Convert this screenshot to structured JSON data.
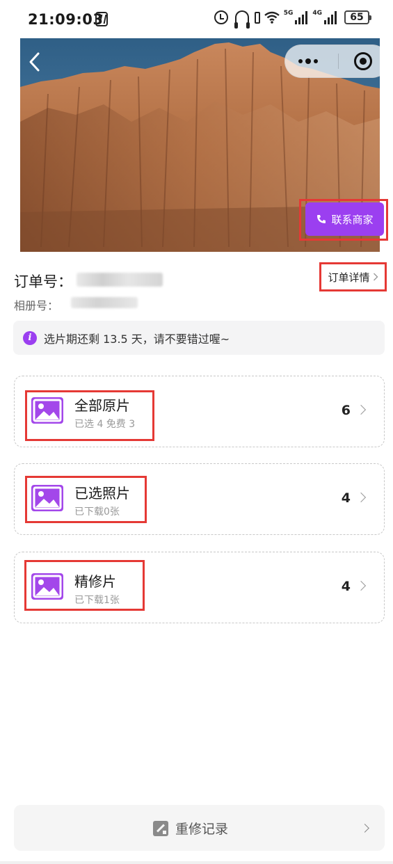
{
  "status_bar": {
    "time": "21:09:03",
    "net_5g": "5G",
    "net_4g": "4G",
    "battery": "65"
  },
  "hero": {
    "contact_label": "联系商家"
  },
  "order": {
    "order_no_label": "订单号：",
    "album_no_label": "相册号：",
    "detail_label": "订单详情"
  },
  "notice": {
    "info_symbol": "i",
    "text": "选片期还剩 13.5 天，请不要错过喔~"
  },
  "cards": [
    {
      "title": "全部原片",
      "subtitle": "已选 4 免费 3",
      "count": "6"
    },
    {
      "title": "已选照片",
      "subtitle": "已下载0张",
      "count": "4"
    },
    {
      "title": "精修片",
      "subtitle": "已下载1张",
      "count": "4"
    }
  ],
  "bottom": {
    "retouch_label": "重修记录"
  },
  "colors": {
    "accent": "#9b3ff0",
    "highlight": "#e53935"
  }
}
